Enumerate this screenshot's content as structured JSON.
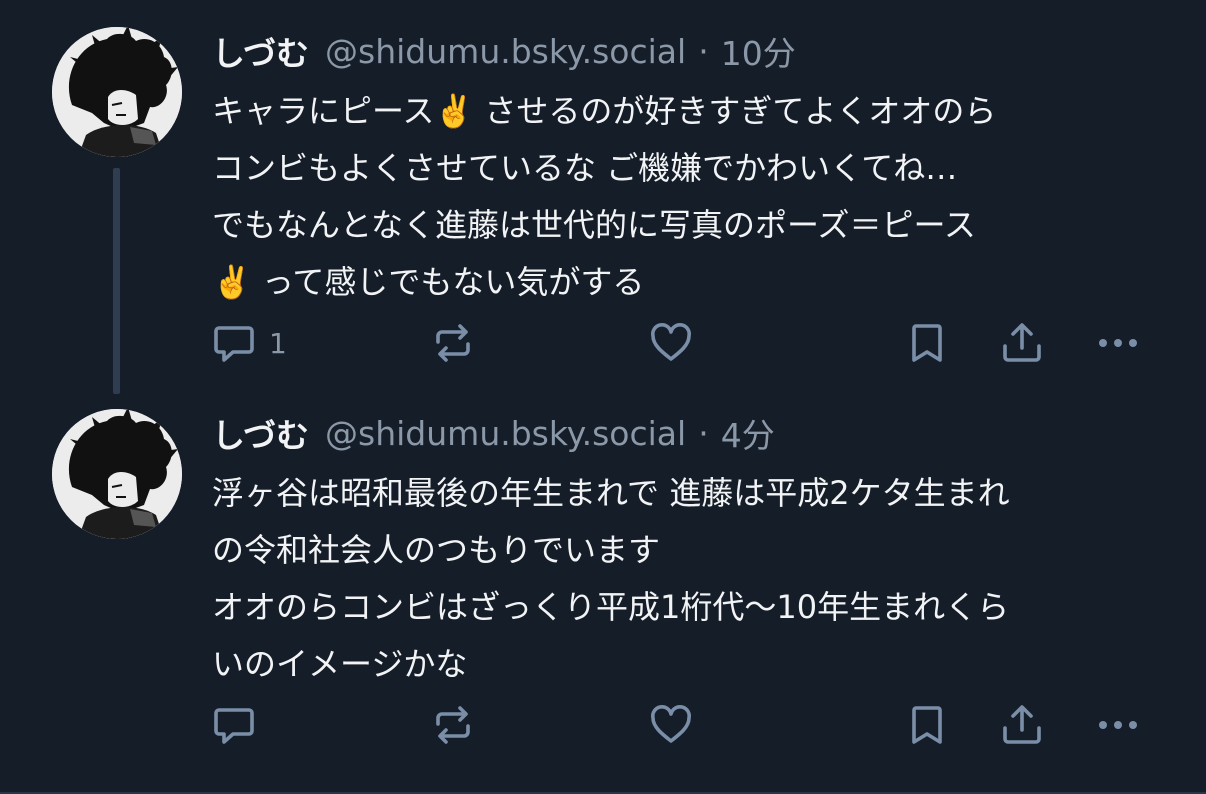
{
  "posts": [
    {
      "display_name": "しづむ",
      "handle": "@shidumu.bsky.social",
      "separator": "·",
      "time": "10分",
      "lines": [
        "キャラにピース✌️ させるのが好きすぎてよくオオのら",
        "コンビもよくさせているな ご機嫌でかわいくてね…",
        "でもなんとなく進藤は世代的に写真のポーズ＝ピース",
        "✌️ って感じでもない気がする"
      ],
      "reply_count": "1",
      "has_thread_line": true
    },
    {
      "display_name": "しづむ",
      "handle": "@shidumu.bsky.social",
      "separator": "·",
      "time": "4分",
      "lines": [
        "浮ヶ谷は昭和最後の年生まれで 進藤は平成2ケタ生まれ",
        "の令和社会人のつもりでいます",
        "オオのらコンビはざっくり平成1桁代〜10年生まれくら",
        "いのイメージかな"
      ],
      "reply_count": "",
      "has_thread_line": false
    }
  ],
  "icons": {
    "reply": "speech-bubble-icon",
    "repost": "repost-arrows-icon",
    "like": "heart-icon",
    "bookmark": "bookmark-icon",
    "share": "share-upload-icon",
    "more": "ellipsis-icon",
    "avatar": "manga-avatar-image"
  },
  "colors": {
    "background": "#151d28",
    "text": "#f1f3f5",
    "muted": "#8b98a8",
    "icon": "#7a8ea8",
    "thread_line": "#2e3d50"
  }
}
